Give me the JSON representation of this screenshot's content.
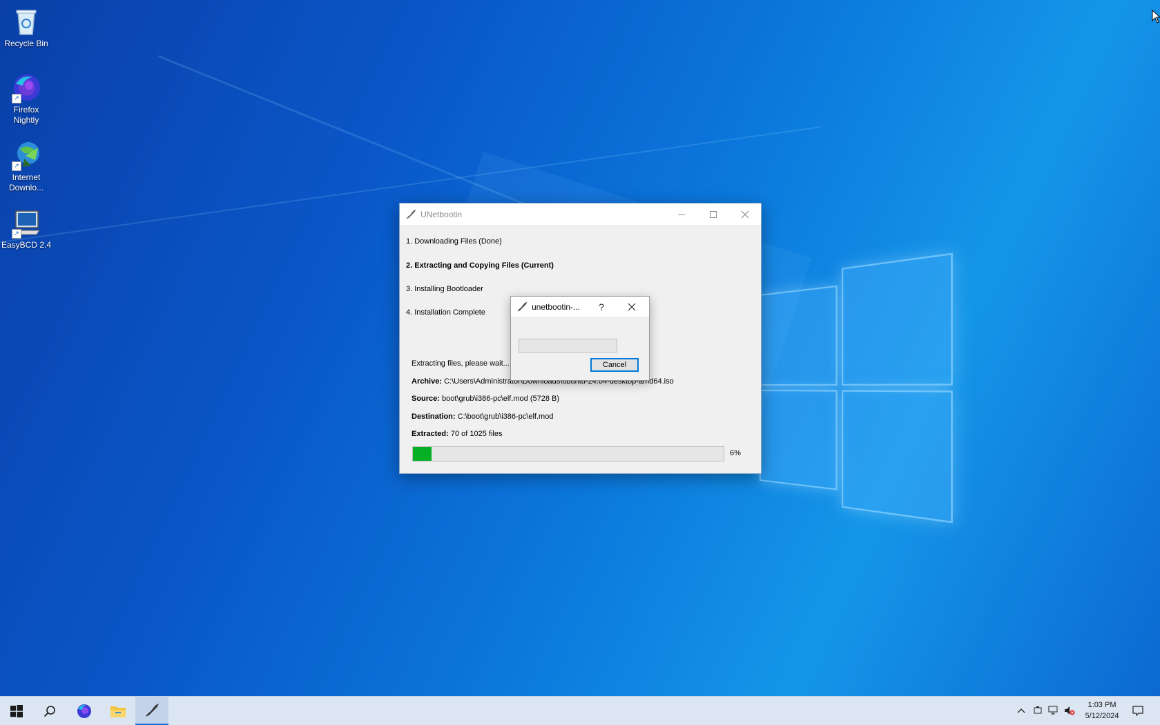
{
  "desktop": {
    "icons": [
      {
        "label": "Recycle Bin",
        "icon": "recycle-bin-icon"
      },
      {
        "label": "Firefox Nightly",
        "icon": "firefox-nightly-icon"
      },
      {
        "label": "Internet Downlo...",
        "icon": "internet-download-manager-icon"
      },
      {
        "label": "EasyBCD 2.4",
        "icon": "easybcd-icon"
      }
    ]
  },
  "main_window": {
    "title": "UNetbootin",
    "steps": [
      "1. Downloading Files (Done)",
      "2. Extracting and Copying Files (Current)",
      "3. Installing Bootloader",
      "4. Installation Complete"
    ],
    "status_text": "Extracting files, please wait...",
    "archive_label": "Archive:",
    "archive_value": "C:\\Users\\Administrator\\Downloads\\ubuntu-24.04-desktop-amd64.iso",
    "source_label": "Source:",
    "source_value": "boot\\grub\\i386-pc\\elf.mod (5728 B)",
    "destination_label": "Destination:",
    "destination_value": "C:\\boot\\grub\\i386-pc\\elf.mod",
    "extracted_label": "Extracted:",
    "extracted_value": "70 of 1025 files",
    "progress_percent": 6,
    "progress_text": "6%"
  },
  "sub_dialog": {
    "title": "unetbootin-...",
    "help_label": "?",
    "progress_percent": 0,
    "cancel_label": "Cancel"
  },
  "taskbar": {
    "time": "1:03 PM",
    "date": "5/12/2024",
    "pinned": [
      "windows-start-icon",
      "search-icon",
      "firefox-icon",
      "file-explorer-icon",
      "unetbootin-icon"
    ]
  },
  "colors": {
    "progress_green": "#06b025",
    "accent_blue": "#0078d7"
  }
}
